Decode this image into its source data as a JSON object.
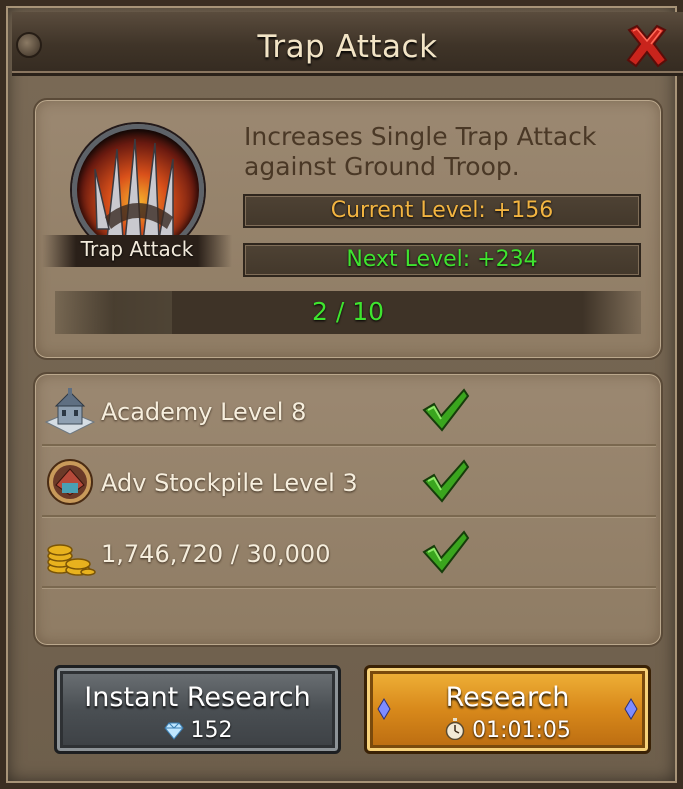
{
  "dialog": {
    "title": "Trap Attack"
  },
  "skill": {
    "name": "Trap Attack",
    "description": "Increases Single Trap Attack against Ground Troop.",
    "current_level": "Current Level: +156",
    "next_level": "Next Level: +234",
    "progress_text": "2 / 10",
    "progress_fraction": 0.2
  },
  "requirements": [
    {
      "icon": "academy-icon",
      "label": "Academy Level 8",
      "met": true
    },
    {
      "icon": "adv-stockpile-icon",
      "label": "Adv Stockpile Level 3",
      "met": true
    },
    {
      "icon": "gold-coins-icon",
      "label": "1,746,720 / 30,000",
      "met": true
    }
  ],
  "buttons": {
    "instant": {
      "label": "Instant Research",
      "cost": "152",
      "icon": "gem-icon"
    },
    "research": {
      "label": "Research",
      "time": "01:01:05",
      "icon": "stopwatch-icon"
    }
  },
  "colors": {
    "current_level": "#f2b441",
    "next_level": "#3fe42f",
    "progress_text": "#3fe42f"
  }
}
